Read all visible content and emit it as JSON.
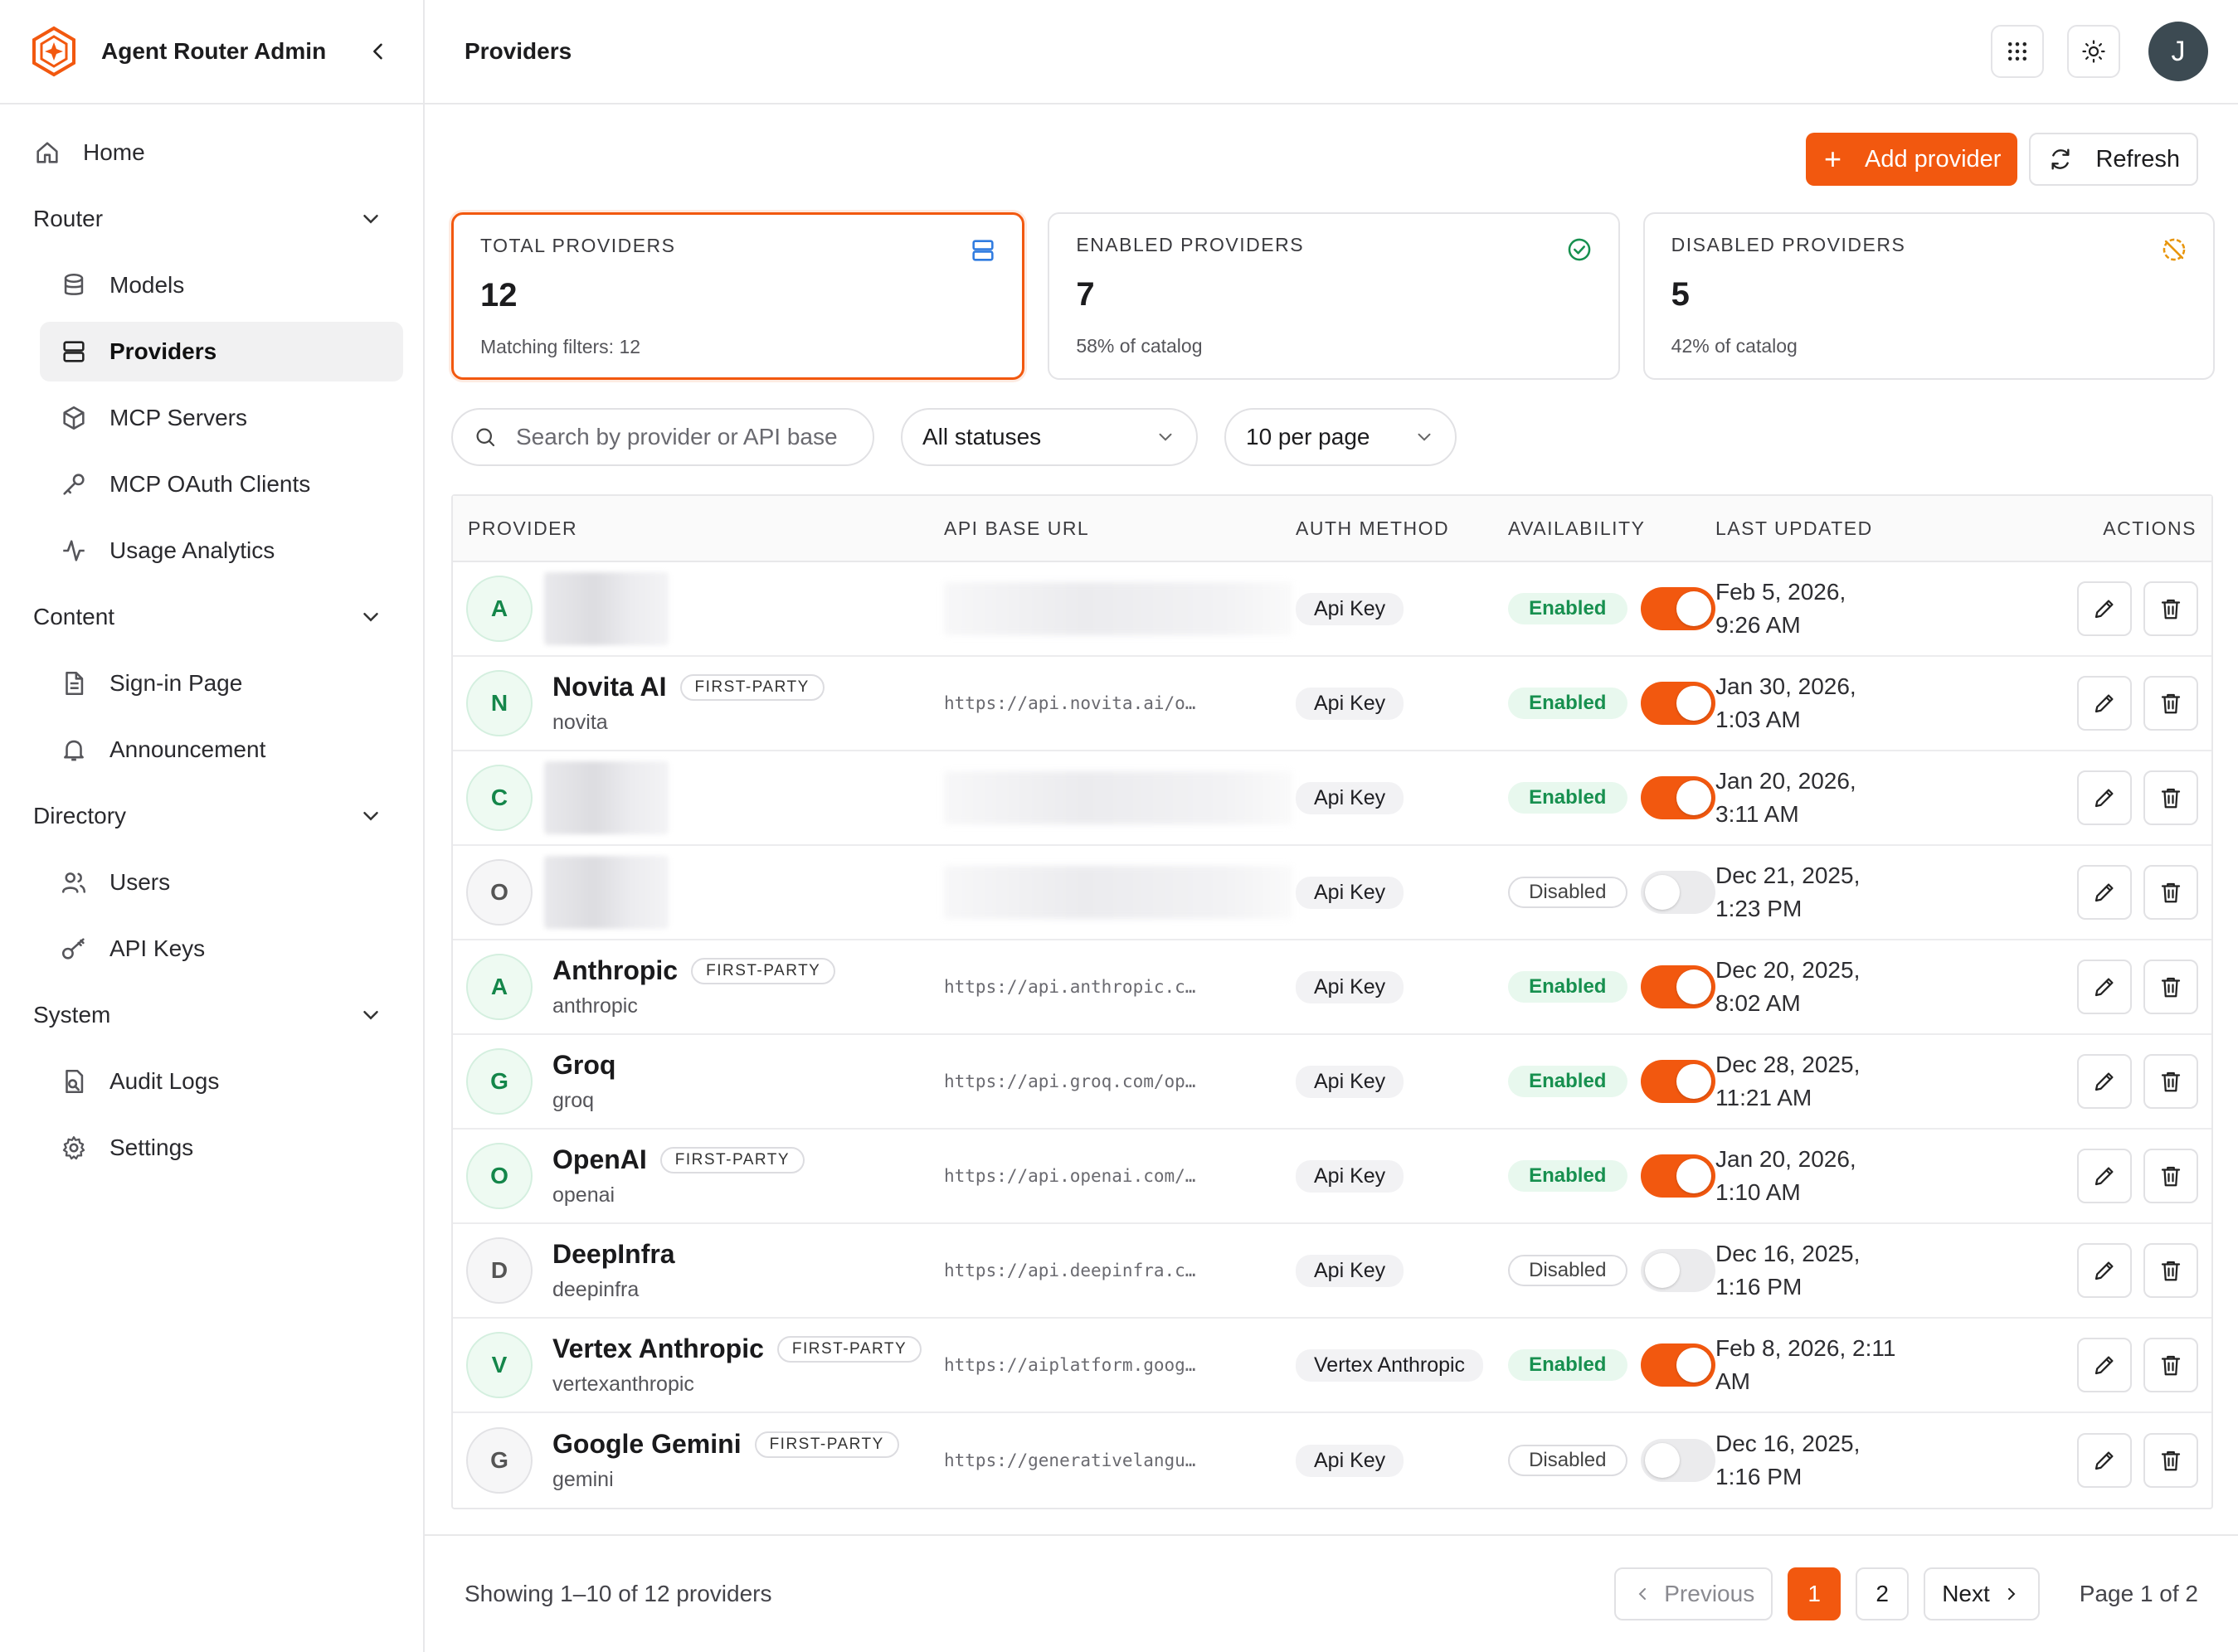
{
  "app": {
    "title": "Agent Router Admin"
  },
  "sidebar": {
    "home": "Home",
    "groups": [
      {
        "label": "Router",
        "items": [
          {
            "label": "Models",
            "icon": "database-icon"
          },
          {
            "label": "Providers",
            "icon": "server-icon",
            "active": true
          },
          {
            "label": "MCP Servers",
            "icon": "cube-icon"
          },
          {
            "label": "MCP OAuth Clients",
            "icon": "key-icon"
          },
          {
            "label": "Usage Analytics",
            "icon": "activity-icon"
          }
        ]
      },
      {
        "label": "Content",
        "items": [
          {
            "label": "Sign-in Page",
            "icon": "file-icon"
          },
          {
            "label": "Announcement",
            "icon": "bell-icon"
          }
        ]
      },
      {
        "label": "Directory",
        "items": [
          {
            "label": "Users",
            "icon": "users-icon"
          },
          {
            "label": "API Keys",
            "icon": "key-icon"
          }
        ]
      },
      {
        "label": "System",
        "items": [
          {
            "label": "Audit Logs",
            "icon": "audit-icon"
          },
          {
            "label": "Settings",
            "icon": "gear-icon"
          }
        ]
      }
    ]
  },
  "header": {
    "title": "Providers",
    "avatar_initial": "J"
  },
  "toolbar": {
    "add_label": "Add provider",
    "refresh_label": "Refresh"
  },
  "stats": [
    {
      "label": "TOTAL PROVIDERS",
      "value": "12",
      "sub": "Matching filters: 12",
      "icon": "server-icon"
    },
    {
      "label": "ENABLED PROVIDERS",
      "value": "7",
      "sub": "58% of catalog",
      "icon": "check-circle-icon"
    },
    {
      "label": "DISABLED PROVIDERS",
      "value": "5",
      "sub": "42% of catalog",
      "icon": "disabled-icon"
    }
  ],
  "filters": {
    "search_placeholder": "Search by provider or API base",
    "status_value": "All statuses",
    "perpage_value": "10 per page"
  },
  "table": {
    "columns": [
      "PROVIDER",
      "API BASE URL",
      "AUTH METHOD",
      "AVAILABILITY",
      "LAST UPDATED",
      "ACTIONS"
    ],
    "rows": [
      {
        "initial": "A",
        "name": "",
        "slug": "",
        "first_party": false,
        "blurred": true,
        "url": "",
        "auth": "Api Key",
        "status": "Enabled",
        "enabled": true,
        "updated_1": "Feb 5, 2026,",
        "updated_2": "9:26 AM"
      },
      {
        "initial": "N",
        "name": "Novita AI",
        "slug": "novita",
        "first_party": true,
        "blurred": false,
        "url": "https://api.novita.ai/o…",
        "auth": "Api Key",
        "status": "Enabled",
        "enabled": true,
        "updated_1": "Jan 30, 2026,",
        "updated_2": "1:03 AM"
      },
      {
        "initial": "C",
        "name": "",
        "slug": "",
        "first_party": false,
        "blurred": true,
        "url": "",
        "auth": "Api Key",
        "status": "Enabled",
        "enabled": true,
        "updated_1": "Jan 20, 2026,",
        "updated_2": "3:11 AM"
      },
      {
        "initial": "O",
        "name": "",
        "slug": "",
        "first_party": false,
        "blurred": true,
        "url": "",
        "auth": "Api Key",
        "status": "Disabled",
        "enabled": false,
        "updated_1": "Dec 21, 2025,",
        "updated_2": "1:23 PM"
      },
      {
        "initial": "A",
        "name": "Anthropic",
        "slug": "anthropic",
        "first_party": true,
        "blurred": false,
        "url": "https://api.anthropic.c…",
        "auth": "Api Key",
        "status": "Enabled",
        "enabled": true,
        "updated_1": "Dec 20, 2025,",
        "updated_2": "8:02 AM"
      },
      {
        "initial": "G",
        "name": "Groq",
        "slug": "groq",
        "first_party": false,
        "blurred": false,
        "url": "https://api.groq.com/op…",
        "auth": "Api Key",
        "status": "Enabled",
        "enabled": true,
        "updated_1": "Dec 28, 2025,",
        "updated_2": "11:21 AM"
      },
      {
        "initial": "O",
        "name": "OpenAI",
        "slug": "openai",
        "first_party": true,
        "blurred": false,
        "url": "https://api.openai.com/…",
        "auth": "Api Key",
        "status": "Enabled",
        "enabled": true,
        "updated_1": "Jan 20, 2026,",
        "updated_2": "1:10 AM"
      },
      {
        "initial": "D",
        "name": "DeepInfra",
        "slug": "deepinfra",
        "first_party": false,
        "blurred": false,
        "url": "https://api.deepinfra.c…",
        "auth": "Api Key",
        "status": "Disabled",
        "enabled": false,
        "updated_1": "Dec 16, 2025,",
        "updated_2": "1:16 PM"
      },
      {
        "initial": "V",
        "name": "Vertex Anthropic",
        "slug": "vertexanthropic",
        "first_party": true,
        "blurred": false,
        "url": "https://aiplatform.goog…",
        "auth": "Vertex Anthropic",
        "status": "Enabled",
        "enabled": true,
        "updated_1": "Feb 8, 2026, 2:11",
        "updated_2": "AM"
      },
      {
        "initial": "G",
        "name": "Google Gemini",
        "slug": "gemini",
        "first_party": true,
        "blurred": false,
        "url": "https://generativelangu…",
        "auth": "Api Key",
        "status": "Disabled",
        "enabled": false,
        "updated_1": "Dec 16, 2025,",
        "updated_2": "1:16 PM"
      }
    ],
    "first_party_label": "FIRST-PARTY"
  },
  "footer": {
    "showing": "Showing 1–10 of 12 providers",
    "previous": "Previous",
    "next": "Next",
    "pages": [
      "1",
      "2"
    ],
    "current_page": "1",
    "page_of": "Page 1 of 2"
  },
  "colors": {
    "accent": "#f2580f",
    "enabled_text": "#17904f",
    "enabled_bg": "#e8f8ee"
  }
}
